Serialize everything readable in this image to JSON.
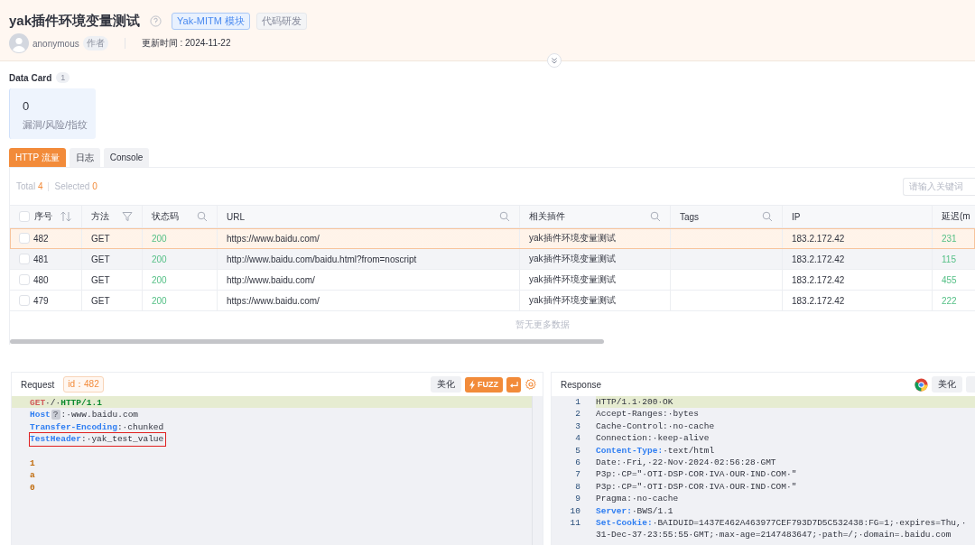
{
  "header": {
    "title": "yak插件环境变量测试",
    "tags": [
      {
        "label": "Yak-MITM 模块",
        "kind": "primary"
      },
      {
        "label": "代码研发",
        "kind": "plain"
      }
    ],
    "author": "anonymous",
    "author_badge": "作者",
    "updated": "更新时间 : 2024-11-22"
  },
  "data_card": {
    "title": "Data Card",
    "count": "1",
    "cards": [
      {
        "value": "0",
        "label": "漏洞/风险/指纹"
      }
    ]
  },
  "tabs": [
    {
      "label": "HTTP 流量",
      "selected": true
    },
    {
      "label": "日志",
      "selected": false
    },
    {
      "label": "Console",
      "selected": false
    }
  ],
  "stats": {
    "total_label": "Total",
    "total": "4",
    "selected_label": "Selected",
    "selected": "0"
  },
  "search": {
    "placeholder": "请输入关键词"
  },
  "table": {
    "columns": [
      {
        "label": "序号",
        "kind": "sort",
        "checked": false
      },
      {
        "label": "方法",
        "kind": "filter"
      },
      {
        "label": "状态码",
        "kind": "search"
      },
      {
        "label": "URL",
        "kind": "search"
      },
      {
        "label": "相关插件",
        "kind": "search"
      },
      {
        "label": "Tags",
        "kind": "search"
      },
      {
        "label": "IP"
      },
      {
        "label": "延迟(m"
      }
    ],
    "rows": [
      {
        "selected": true,
        "hovered": false,
        "checked": false,
        "cells": [
          "482",
          "GET",
          "200",
          "https://www.baidu.com/",
          "yak插件环境变量测试",
          "",
          "183.2.172.42",
          "231"
        ]
      },
      {
        "selected": false,
        "hovered": true,
        "checked": false,
        "cells": [
          "481",
          "GET",
          "200",
          "http://www.baidu.com/baidu.html?from=noscript",
          "yak插件环境变量测试",
          "",
          "183.2.172.42",
          "115"
        ]
      },
      {
        "selected": false,
        "hovered": false,
        "checked": false,
        "cells": [
          "480",
          "GET",
          "200",
          "http://www.baidu.com/",
          "yak插件环境变量测试",
          "",
          "183.2.172.42",
          "455"
        ]
      },
      {
        "selected": false,
        "hovered": false,
        "checked": false,
        "cells": [
          "479",
          "GET",
          "200",
          "https://www.baidu.com/",
          "yak插件环境变量测试",
          "",
          "183.2.172.42",
          "222"
        ]
      }
    ],
    "empty_note": "暂无更多数据"
  },
  "request": {
    "title": "Request",
    "id_badge": "id：482",
    "buttons": [
      {
        "label": "美化",
        "kind": "plain"
      },
      {
        "label": "FUZZ",
        "kind": "fuzz"
      },
      {
        "kind": "wrap"
      }
    ],
    "lines": [
      {
        "highlighted": false,
        "current": true,
        "segments": [
          {
            "text": "GET",
            "kind": "method"
          },
          {
            "text": "·/·",
            "kind": "plain"
          },
          {
            "text": "HTTP/1.1",
            "kind": "version"
          }
        ]
      },
      {
        "highlighted": false,
        "current": false,
        "segments": [
          {
            "text": "Host",
            "kind": "key"
          },
          {
            "text": "?",
            "kind": "hint"
          },
          {
            "text": ":·www.baidu.com",
            "kind": "plain"
          }
        ]
      },
      {
        "highlighted": false,
        "current": false,
        "segments": [
          {
            "text": "Transfer-Encoding",
            "kind": "key"
          },
          {
            "text": ":·chunked",
            "kind": "plain"
          }
        ]
      },
      {
        "highlighted": true,
        "current": false,
        "segments": [
          {
            "text": "TestHeader",
            "kind": "key"
          },
          {
            "text": ":·yak_test_value",
            "kind": "plain"
          }
        ]
      },
      {
        "highlighted": false,
        "current": false
      },
      {
        "highlighted": false,
        "current": false,
        "segments": [
          {
            "text": "1",
            "kind": "body"
          }
        ]
      },
      {
        "highlighted": false,
        "current": false,
        "segments": [
          {
            "text": "a",
            "kind": "body"
          }
        ]
      },
      {
        "highlighted": false,
        "current": false,
        "segments": [
          {
            "text": "0",
            "kind": "body"
          }
        ]
      }
    ]
  },
  "response": {
    "title": "Response",
    "buttons": [
      {
        "label": "美化",
        "kind": "plain"
      }
    ],
    "lines": [
      {
        "number": "1",
        "current": true,
        "segments": [
          {
            "text": "HTTP/1.1·200·OK",
            "kind": "plain"
          }
        ]
      },
      {
        "number": "2",
        "current": false,
        "segments": [
          {
            "text": "Accept-Ranges:·bytes",
            "kind": "plain"
          }
        ]
      },
      {
        "number": "3",
        "current": false,
        "segments": [
          {
            "text": "Cache-Control:·no-cache",
            "kind": "plain"
          }
        ]
      },
      {
        "number": "4",
        "current": false,
        "segments": [
          {
            "text": "Connection:·keep-alive",
            "kind": "plain"
          }
        ]
      },
      {
        "number": "5",
        "current": false,
        "segments": [
          {
            "text": "Content-Type:",
            "kind": "key"
          },
          {
            "text": "·text/html",
            "kind": "plain"
          }
        ]
      },
      {
        "number": "6",
        "current": false,
        "segments": [
          {
            "text": "Date:·Fri,·22·Nov·2024·02:56:28·GMT",
            "kind": "plain"
          }
        ]
      },
      {
        "number": "7",
        "current": false,
        "segments": [
          {
            "text": "P3p:·CP=\"·OTI·DSP·COR·IVA·OUR·IND·COM·\"",
            "kind": "plain"
          }
        ]
      },
      {
        "number": "8",
        "current": false,
        "segments": [
          {
            "text": "P3p:·CP=\"·OTI·DSP·COR·IVA·OUR·IND·COM·\"",
            "kind": "plain"
          }
        ]
      },
      {
        "number": "9",
        "current": false,
        "segments": [
          {
            "text": "Pragma:·no-cache",
            "kind": "plain"
          }
        ]
      },
      {
        "number": "10",
        "current": false,
        "segments": [
          {
            "text": "Server:",
            "kind": "key"
          },
          {
            "text": "·BWS/1.1",
            "kind": "plain"
          }
        ]
      },
      {
        "number": "11",
        "current": false,
        "segments": [
          {
            "text": "Set-Cookie:",
            "kind": "key"
          },
          {
            "text": "·BAIDUID=1437E462A463977CEF793D7D5C532438:FG=1;·expires=Thu,·",
            "kind": "plain"
          }
        ]
      },
      {
        "current": false,
        "segments": [
          {
            "text": "31-Dec-37·23:55:55·GMT;·max-age=2147483647;·path=/;·domain=.baidu.com",
            "kind": "plain"
          }
        ]
      }
    ]
  }
}
